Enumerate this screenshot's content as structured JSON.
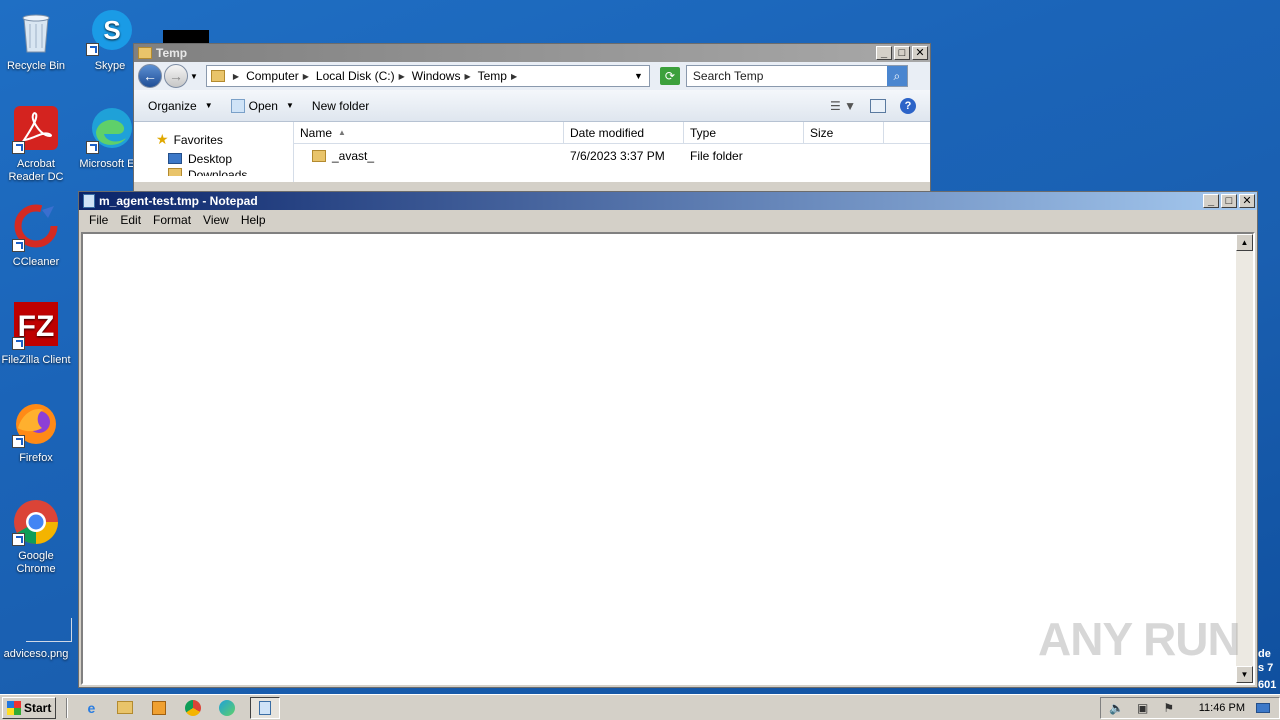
{
  "desktop": {
    "icons": [
      {
        "label": "Recycle Bin",
        "icon": "recycle-bin-icon"
      },
      {
        "label": "Skype",
        "icon": "skype-icon"
      },
      {
        "label": "Acrobat Reader DC",
        "icon": "acrobat-icon"
      },
      {
        "label": "Microsoft Ed",
        "icon": "edge-icon"
      },
      {
        "label": "CCleaner",
        "icon": "ccleaner-icon"
      },
      {
        "label": "FileZilla Client",
        "icon": "filezilla-icon"
      },
      {
        "label": "Firefox",
        "icon": "firefox-icon"
      },
      {
        "label": "Google Chrome",
        "icon": "chrome-icon"
      },
      {
        "label": "adviceso.png",
        "icon": "image-file-icon"
      }
    ],
    "edge_text": [
      "de",
      "s 7",
      "601"
    ]
  },
  "explorer": {
    "title": "Temp",
    "address": {
      "crumbs": [
        "Computer",
        "Local Disk (C:)",
        "Windows",
        "Temp"
      ]
    },
    "search_placeholder": "Search Temp",
    "toolbar": {
      "organize": "Organize",
      "open": "Open",
      "new_folder": "New folder"
    },
    "nav": {
      "favorites": "Favorites",
      "desktop": "Desktop",
      "downloads": "Downloads"
    },
    "columns": [
      "Name",
      "Date modified",
      "Type",
      "Size"
    ],
    "rows": [
      {
        "name": "_avast_",
        "date": "7/6/2023 3:37 PM",
        "type": "File folder",
        "size": ""
      }
    ]
  },
  "notepad": {
    "title": "m_agent-test.tmp - Notepad",
    "menu": [
      "File",
      "Edit",
      "Format",
      "View",
      "Help"
    ],
    "content": ""
  },
  "watermark": "ANY RUN",
  "taskbar": {
    "start_label": "Start",
    "clock": "11:46 PM"
  },
  "colors": {
    "desktop_bg": "#1b64b8",
    "notepad_title_active": "#0a246a",
    "explorer_title_inactive": "#808080"
  }
}
